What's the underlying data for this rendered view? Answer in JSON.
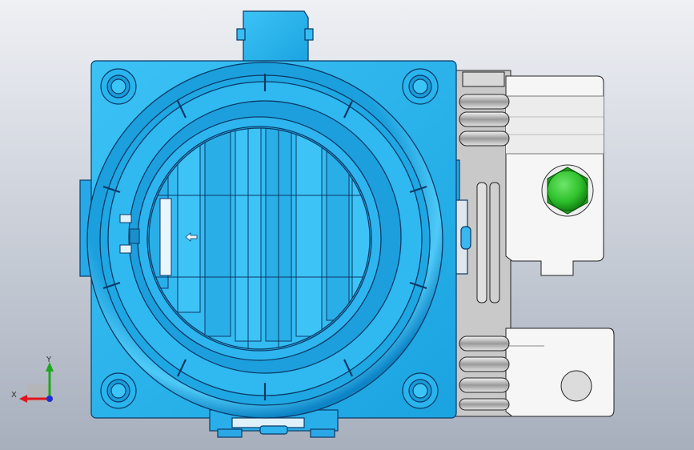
{
  "viewport": {
    "background_top": "#eef0f4",
    "background_bottom": "#a7afbd"
  },
  "colors": {
    "part_blue": "#26b3ee",
    "part_blue_dark": "#0a6fb3",
    "part_blue_light": "#7ad7ff",
    "edge": "#0b3a66",
    "bracket_fill": "#f4f4f4",
    "bracket_shadow": "#b8b8b8",
    "bolt_green": "#2fc12c",
    "bolt_green_dark": "#0d7a10",
    "axis_x": "#e0141b",
    "axis_y": "#1ea81e",
    "axis_z": "#1b2fd6"
  },
  "triad": {
    "x_label": "X",
    "y_label": "Y"
  }
}
